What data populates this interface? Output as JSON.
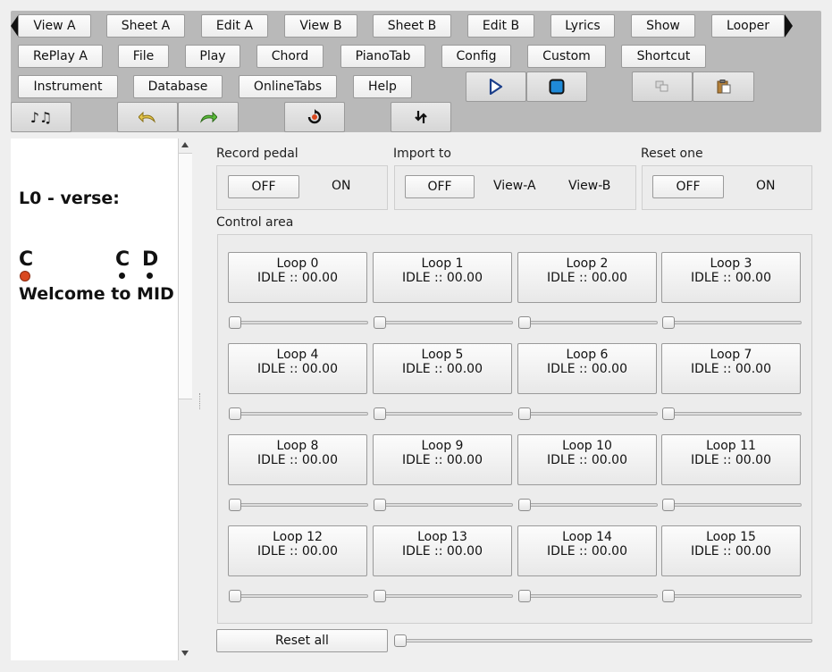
{
  "toolbar": {
    "tabs_row1": [
      "View A",
      "Sheet A",
      "Edit A",
      "View B",
      "Sheet B",
      "Edit B",
      "Lyrics",
      "Show",
      "Looper"
    ],
    "tabs_row2": [
      "RePlay A",
      "File",
      "Play",
      "Chord",
      "PianoTab",
      "Config",
      "Custom",
      "Shortcut"
    ],
    "tabs_row3": [
      "Instrument",
      "Database",
      "OnlineTabs",
      "Help"
    ],
    "icons": {
      "play": "play-icon",
      "stop": "stop-icon",
      "copy": "copy-icon",
      "paste": "paste-icon",
      "notes": "music-notes-icon",
      "undo": "undo-icon",
      "redo": "redo-icon",
      "record": "record-loop-icon",
      "swap": "swap-arrows-icon"
    },
    "colors": {
      "background": "#b9b9b9",
      "play": "#1c3f8a",
      "stop": "#1f8ad8"
    }
  },
  "sheet": {
    "heading": "L0 - verse:",
    "chords": [
      "C",
      "C",
      "D"
    ],
    "lyric": "Welcome to MID",
    "marker_color": "#d9481f"
  },
  "record_pedal": {
    "title": "Record pedal",
    "off": "OFF",
    "on": "ON"
  },
  "import_to": {
    "title": "Import to",
    "off": "OFF",
    "view_a": "View-A",
    "view_b": "View-B"
  },
  "reset_one": {
    "title": "Reset one",
    "off": "OFF",
    "on": "ON"
  },
  "control_area": {
    "title": "Control area"
  },
  "loops": [
    {
      "name": "Loop 0",
      "status": "IDLE :: 00.00"
    },
    {
      "name": "Loop 1",
      "status": "IDLE :: 00.00"
    },
    {
      "name": "Loop 2",
      "status": "IDLE :: 00.00"
    },
    {
      "name": "Loop 3",
      "status": "IDLE :: 00.00"
    },
    {
      "name": "Loop 4",
      "status": "IDLE :: 00.00"
    },
    {
      "name": "Loop 5",
      "status": "IDLE :: 00.00"
    },
    {
      "name": "Loop 6",
      "status": "IDLE :: 00.00"
    },
    {
      "name": "Loop 7",
      "status": "IDLE :: 00.00"
    },
    {
      "name": "Loop 8",
      "status": "IDLE :: 00.00"
    },
    {
      "name": "Loop 9",
      "status": "IDLE :: 00.00"
    },
    {
      "name": "Loop 10",
      "status": "IDLE :: 00.00"
    },
    {
      "name": "Loop 11",
      "status": "IDLE :: 00.00"
    },
    {
      "name": "Loop 12",
      "status": "IDLE :: 00.00"
    },
    {
      "name": "Loop 13",
      "status": "IDLE :: 00.00"
    },
    {
      "name": "Loop 14",
      "status": "IDLE :: 00.00"
    },
    {
      "name": "Loop 15",
      "status": "IDLE :: 00.00"
    }
  ],
  "loop_levels": [
    0,
    0,
    0,
    0,
    0,
    0,
    0,
    0,
    0,
    0,
    0,
    0,
    0,
    0,
    0,
    0
  ],
  "reset_all": {
    "label": "Reset all",
    "level": 0
  }
}
